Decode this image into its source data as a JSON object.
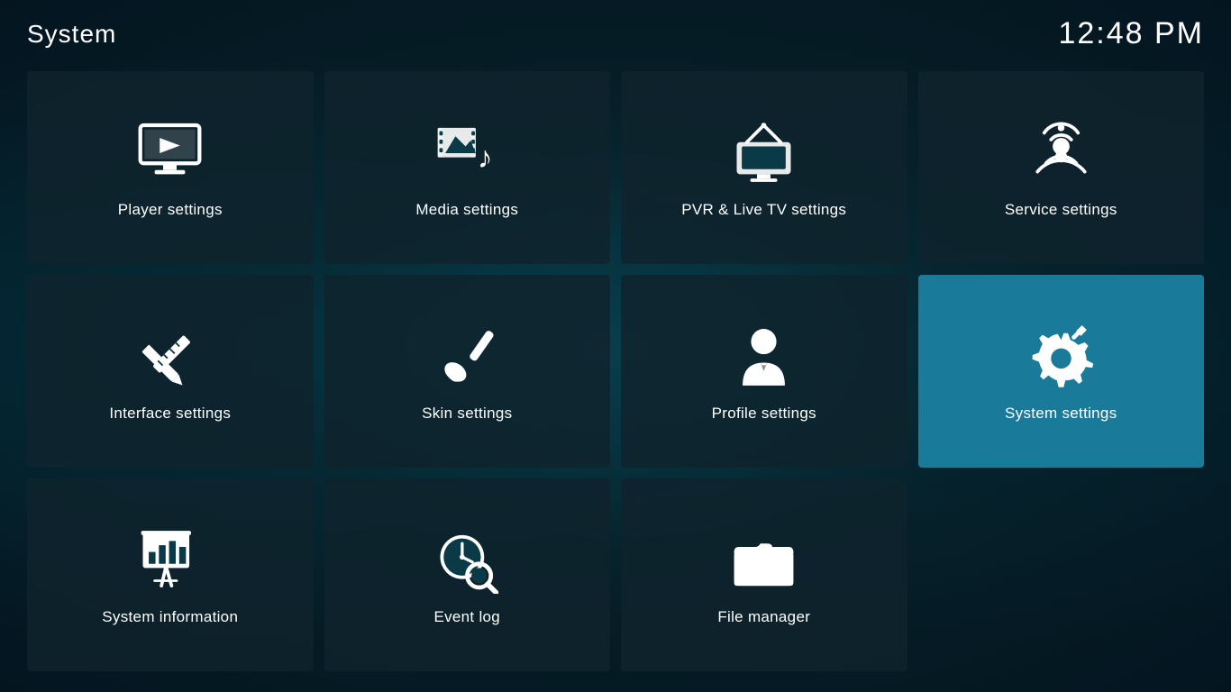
{
  "header": {
    "title": "System",
    "time": "12:48 PM"
  },
  "grid": {
    "items": [
      {
        "id": "player-settings",
        "label": "Player settings",
        "icon": "player",
        "active": false
      },
      {
        "id": "media-settings",
        "label": "Media settings",
        "icon": "media",
        "active": false
      },
      {
        "id": "pvr-settings",
        "label": "PVR & Live TV settings",
        "icon": "pvr",
        "active": false
      },
      {
        "id": "service-settings",
        "label": "Service settings",
        "icon": "service",
        "active": false
      },
      {
        "id": "interface-settings",
        "label": "Interface settings",
        "icon": "interface",
        "active": false
      },
      {
        "id": "skin-settings",
        "label": "Skin settings",
        "icon": "skin",
        "active": false
      },
      {
        "id": "profile-settings",
        "label": "Profile settings",
        "icon": "profile",
        "active": false
      },
      {
        "id": "system-settings",
        "label": "System settings",
        "icon": "system",
        "active": true
      },
      {
        "id": "system-information",
        "label": "System information",
        "icon": "sysinfo",
        "active": false
      },
      {
        "id": "event-log",
        "label": "Event log",
        "icon": "eventlog",
        "active": false
      },
      {
        "id": "file-manager",
        "label": "File manager",
        "icon": "filemanager",
        "active": false
      }
    ]
  }
}
